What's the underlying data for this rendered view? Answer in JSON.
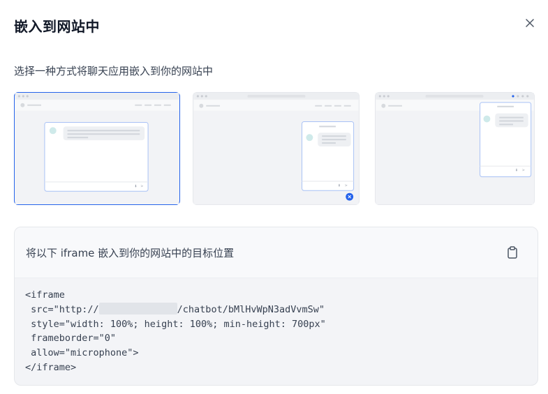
{
  "dialog": {
    "title": "嵌入到网站中",
    "subtitle": "选择一种方式将聊天应用嵌入到你的网站中"
  },
  "options": [
    {
      "id": "full-page",
      "selected": true
    },
    {
      "id": "bubble-widget",
      "selected": false
    },
    {
      "id": "chrome-extension",
      "selected": false
    }
  ],
  "code_panel": {
    "label": "将以下 iframe 嵌入到你的网站中的目标位置",
    "lines": {
      "l1": "<iframe",
      "l2_prefix": " src=\"http://",
      "l2_suffix": "/chatbot/bMlHvWpN3adVvmSw\"",
      "l3": " style=\"width: 100%; height: 100%; min-height: 700px\"",
      "l4": " frameborder=\"0\"",
      "l5": " allow=\"microphone\">",
      "l6": "</iframe>"
    }
  },
  "colors": {
    "accent": "#2563eb",
    "panel_bg": "#f3f4f7"
  },
  "icons": {
    "close": "close-icon",
    "copy": "clipboard-icon"
  }
}
